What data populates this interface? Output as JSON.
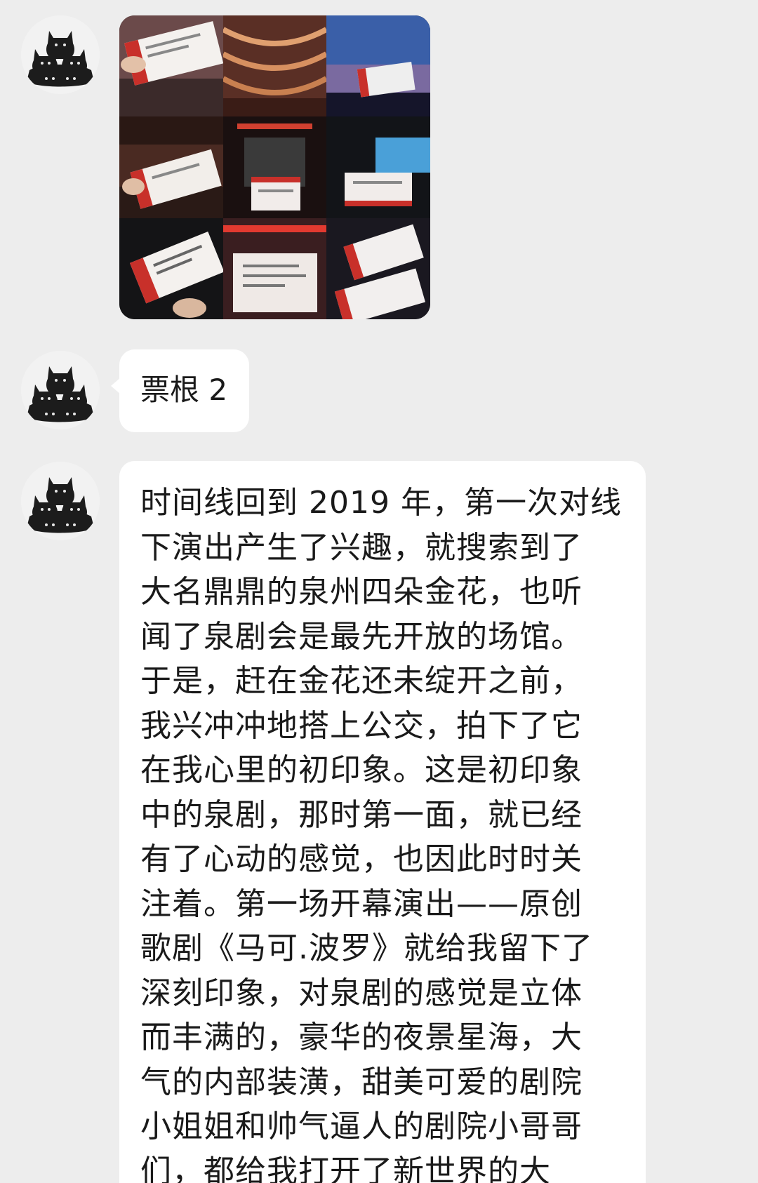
{
  "messages": [
    {
      "type": "image",
      "description_name": "ticket-stub-collage",
      "tiles": 9
    },
    {
      "type": "text",
      "text": "票根 2"
    },
    {
      "type": "text",
      "lines": [
        "时间线回到 2019 年，第一次对线",
        "下演出产生了兴趣，就搜索到了",
        "大名鼎鼎的泉州四朵金花，也听",
        "闻了泉剧会是最先开放的场馆。",
        "于是，赶在金花还未绽开之前，",
        "我兴冲冲地搭上公交，拍下了它",
        "在我心里的初印象。这是初印象",
        "中的泉剧，那时第一面，就已经",
        "有了心动的感觉，也因此时时关",
        "注着。第一场开幕演出——原创",
        "歌剧《马可.波罗》就给我留下了",
        "深刻印象，对泉剧的感觉是立体",
        "而丰满的，豪华的夜景星海，大",
        "气的内部装潢，甜美可爱的剧院",
        "小姐姐和帅气逼人的剧院小哥哥",
        "们，都给我打开了新世界的大"
      ]
    }
  ],
  "colors": {
    "background": "#ededed",
    "bubble": "#ffffff",
    "text": "#1a1a1a"
  },
  "icons": {
    "avatar": "black-cats-avatar-icon"
  }
}
